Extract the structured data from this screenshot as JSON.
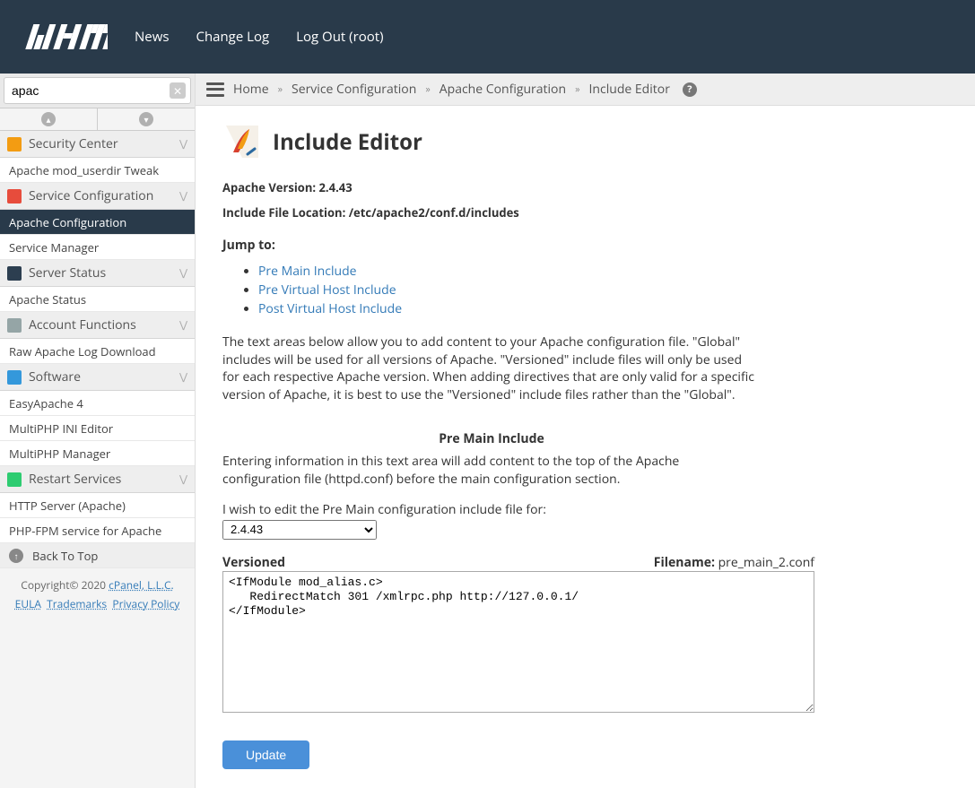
{
  "header": {
    "brand": "WHM",
    "nav": [
      "News",
      "Change Log",
      "Log Out (root)"
    ]
  },
  "search": {
    "value": "apac"
  },
  "sidebar": {
    "groups": [
      {
        "label": "Security Center",
        "icon_color": "#f39c12",
        "items": [
          {
            "label": "Apache mod_userdir Tweak",
            "active": false
          }
        ]
      },
      {
        "label": "Service Configuration",
        "icon_color": "#e74c3c",
        "items": [
          {
            "label": "Apache Configuration",
            "active": true
          },
          {
            "label": "Service Manager",
            "active": false
          }
        ]
      },
      {
        "label": "Server Status",
        "icon_color": "#2c3e50",
        "items": [
          {
            "label": "Apache Status",
            "active": false
          }
        ]
      },
      {
        "label": "Account Functions",
        "icon_color": "#95a5a6",
        "items": [
          {
            "label": "Raw Apache Log Download",
            "active": false
          }
        ]
      },
      {
        "label": "Software",
        "icon_color": "#3498db",
        "items": [
          {
            "label": "EasyApache 4",
            "active": false
          },
          {
            "label": "MultiPHP INI Editor",
            "active": false
          },
          {
            "label": "MultiPHP Manager",
            "active": false
          }
        ]
      },
      {
        "label": "Restart Services",
        "icon_color": "#2ecc71",
        "items": [
          {
            "label": "HTTP Server (Apache)",
            "active": false
          },
          {
            "label": "PHP-FPM service for Apache",
            "active": false
          }
        ]
      }
    ],
    "back_to_top": "Back To Top",
    "footer": {
      "copyright": "Copyright© 2020 ",
      "cpanel": "cPanel, L.L.C.",
      "links": [
        "EULA",
        "Trademarks",
        "Privacy Policy"
      ]
    }
  },
  "breadcrumb": [
    "Home",
    "Service Configuration",
    "Apache Configuration",
    "Include Editor"
  ],
  "page": {
    "title": "Include Editor",
    "apache_version_label": "Apache Version:",
    "apache_version": "2.4.43",
    "include_loc_label": "Include File Location:",
    "include_loc": "/etc/apache2/conf.d/includes",
    "jump_label": "Jump to:",
    "jump_links": [
      "Pre Main Include",
      "Pre Virtual Host Include",
      "Post Virtual Host Include"
    ],
    "description": "The text areas below allow you to add content to your Apache configuration file. \"Global\" includes will be used for all versions of Apache. \"Versioned\" include files will only be used for each respective Apache version. When adding directives that are only valid for a specific version of Apache, it is best to use the \"Versioned\" include files rather than the \"Global\".",
    "section": {
      "heading": "Pre Main Include",
      "desc": "Entering information in this text area will add content to the top of the Apache configuration file (httpd.conf) before the main configuration section.",
      "select_label": "I wish to edit the Pre Main configuration include file for:",
      "select_value": "2.4.43",
      "versioned_label": "Versioned",
      "filename_label": "Filename:",
      "filename": "pre_main_2.conf",
      "textarea_value": "<IfModule mod_alias.c>\n   RedirectMatch 301 /xmlrpc.php http://127.0.0.1/\n</IfModule>",
      "update_btn": "Update"
    }
  }
}
